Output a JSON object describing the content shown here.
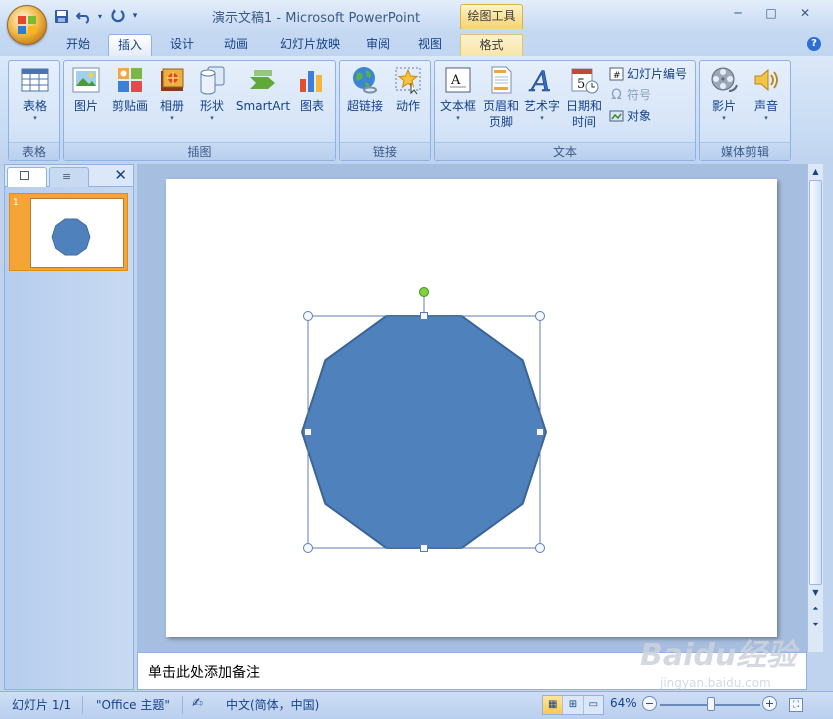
{
  "window": {
    "title": "演示文稿1 - Microsoft PowerPoint",
    "contextual_tab_group": "绘图工具",
    "minimize_icon": "minimize-icon",
    "maximize_icon": "maximize-icon",
    "close_icon": "close-icon"
  },
  "quick_access": {
    "save_icon": "save-icon",
    "undo_icon": "undo-icon",
    "redo_icon": "redo-icon",
    "customize_icon": "dropdown-icon"
  },
  "tabs": [
    {
      "label": "开始"
    },
    {
      "label": "插入"
    },
    {
      "label": "设计"
    },
    {
      "label": "动画"
    },
    {
      "label": "幻灯片放映"
    },
    {
      "label": "审阅"
    },
    {
      "label": "视图"
    },
    {
      "label": "格式"
    }
  ],
  "active_tab": "插入",
  "ribbon": {
    "groups": {
      "table": {
        "label": "表格",
        "buttons": {
          "table": "表格"
        }
      },
      "illustrations": {
        "label": "插图",
        "buttons": {
          "picture": "图片",
          "clipart": "剪贴画",
          "album": "相册",
          "shapes": "形状",
          "smartart": "SmartArt",
          "chart": "图表"
        }
      },
      "links": {
        "label": "链接",
        "buttons": {
          "hyperlink": "超链接",
          "action": "动作"
        }
      },
      "text": {
        "label": "文本",
        "buttons": {
          "textbox": "文本框",
          "header_footer_l1": "页眉和",
          "header_footer_l2": "页脚",
          "wordart": "艺术字",
          "datetime_l1": "日期和",
          "datetime_l2": "时间",
          "slide_number": "幻灯片编号",
          "symbol": "符号",
          "object": "对象"
        }
      },
      "media": {
        "label": "媒体剪辑",
        "buttons": {
          "movie": "影片",
          "sound": "声音"
        }
      }
    }
  },
  "panel": {
    "slide_number": "1"
  },
  "slide": {
    "shape": "decagon",
    "fill_color": "#4f81bd",
    "stroke_color": "#3a6595",
    "selected": true
  },
  "notes": {
    "placeholder": "单击此处添加备注"
  },
  "status": {
    "slide_info": "幻灯片 1/1",
    "theme": "\"Office 主题\"",
    "language": "中文(简体，中国)",
    "zoom": "64%",
    "zoom_value": 64
  },
  "colors": {
    "accent": "#4f81bd",
    "ribbon": "#dbe8f8",
    "selected_slide": "#f5a536"
  }
}
